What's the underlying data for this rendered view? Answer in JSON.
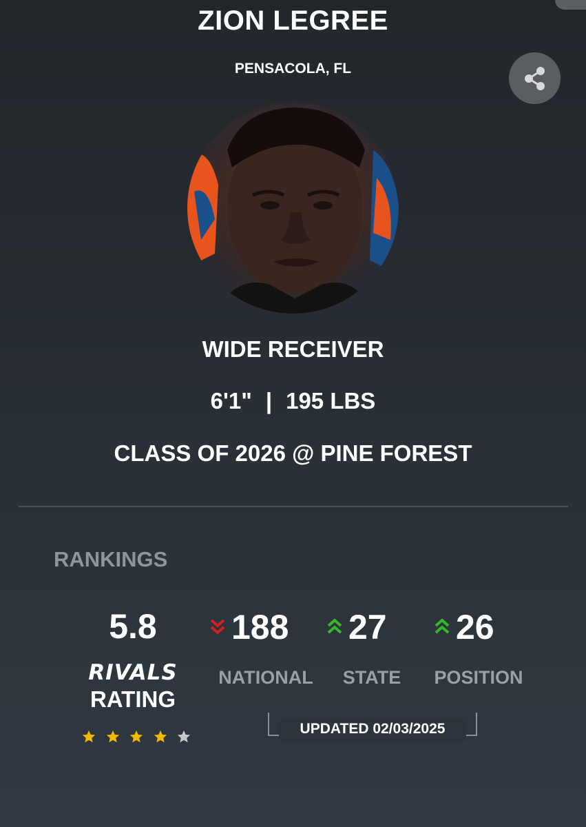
{
  "profile": {
    "name": "ZION LEGREE",
    "location": "PENSACOLA, FL",
    "position": "WIDE RECEIVER",
    "height": "6'1\"",
    "separator": "|",
    "weight": "195 LBS",
    "class_line": "CLASS OF 2026 @ PINE FOREST"
  },
  "icons": {
    "share": "share-icon",
    "avatar": "player-photo"
  },
  "rankings": {
    "heading": "RANKINGS",
    "rating": {
      "value": "5.8",
      "brand": "RIVALS",
      "label": "RATING",
      "stars_filled": 4,
      "stars_total": 5
    },
    "national": {
      "value": "188",
      "label": "NATIONAL",
      "trend": "down"
    },
    "state": {
      "value": "27",
      "label": "STATE",
      "trend": "up"
    },
    "position": {
      "value": "26",
      "label": "POSITION",
      "trend": "up"
    },
    "updated": "UPDATED 02/03/2025"
  },
  "colors": {
    "star_filled": "#f5b800",
    "star_empty": "#c8c8c8",
    "trend_up": "#33b82c",
    "trend_down": "#d21f1f",
    "muted_label": "#9aa0a5"
  }
}
